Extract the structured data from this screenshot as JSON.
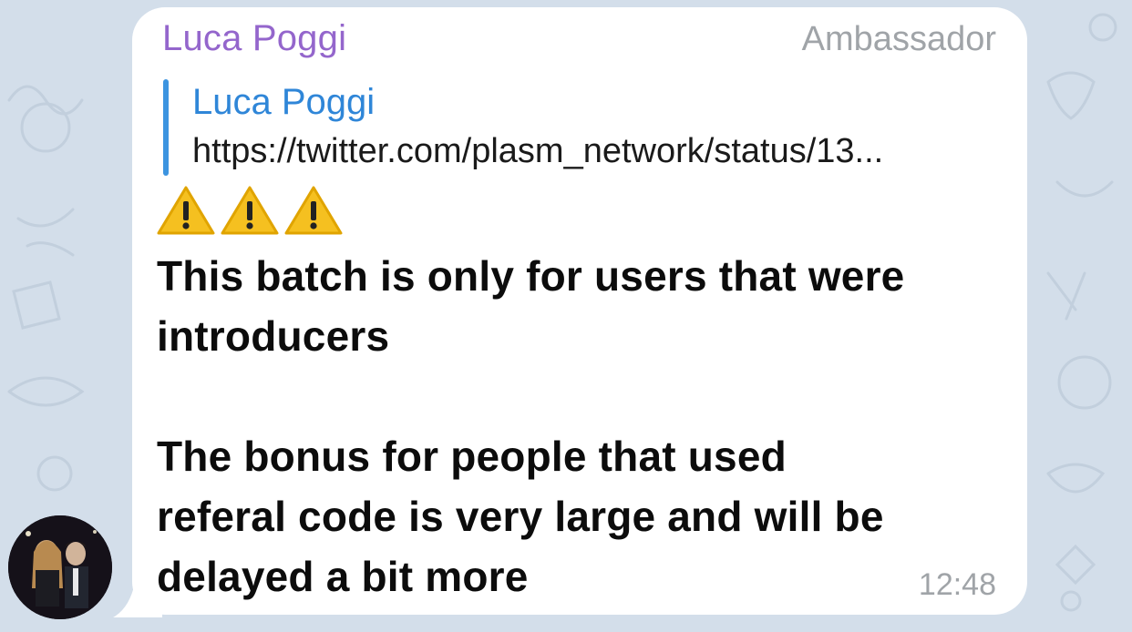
{
  "message": {
    "sender_name": "Luca Poggi",
    "sender_role": "Ambassador",
    "reply": {
      "author": "Luca Poggi",
      "preview": "https://twitter.com/plasm_network/status/13..."
    },
    "emoji": [
      "⚠️",
      "⚠️",
      "⚠️"
    ],
    "text_lines": [
      "This batch is only for users that were",
      "introducers",
      "",
      "The bonus for people that used",
      "referal code is very large and will be",
      "delayed a bit more"
    ],
    "time": "12:48"
  },
  "colors": {
    "wallpaper": "#d3deea",
    "bubble": "#ffffff",
    "sender_name": "#9466cc",
    "reply_accent": "#3c94e0",
    "meta_text": "#a0a4a8"
  }
}
